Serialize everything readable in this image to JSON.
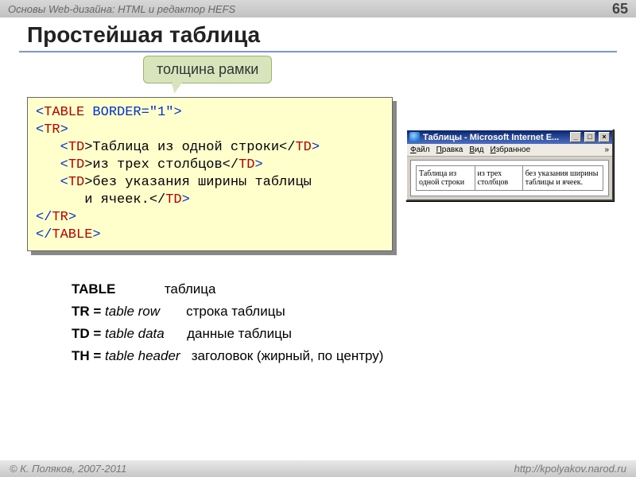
{
  "header": {
    "breadcrumb": "Основы Web-дизайна: HTML и редактор HEFS",
    "page": "65"
  },
  "title": "Простейшая таблица",
  "callout": "толщина рамки",
  "code": {
    "l1a": "<",
    "l1b": "TABLE",
    "l1c": " BORDER=\"1\"",
    "l1d": ">",
    "l2a": "<",
    "l2b": "TR",
    "l2c": ">",
    "l3a": "   <",
    "l3b": "TD",
    "l3c": ">Таблица из одной строки</",
    "l3d": "TD",
    "l3e": ">",
    "l4a": "   <",
    "l4b": "TD",
    "l4c": ">из трех столбцов</",
    "l4d": "TD",
    "l4e": ">",
    "l5a": "   <",
    "l5b": "TD",
    "l5c": ">без указания ширины таблицы",
    "l6": "      и ячеек.</",
    "l6b": "TD",
    "l6c": ">",
    "l7a": "</",
    "l7b": "TR",
    "l7c": ">",
    "l8a": "</",
    "l8b": "TABLE",
    "l8c": ">"
  },
  "browser": {
    "title": "Таблицы - Microsoft Internet E...",
    "menu": {
      "file": "Файл",
      "edit": "Правка",
      "view": "Вид",
      "fav": "Избранное"
    },
    "cells": {
      "c1": "Таблица из одной строки",
      "c2": "из трех столбцов",
      "c3": "без указания ширины таблицы и ячеек."
    }
  },
  "defs": {
    "r1a": "TABLE",
    "r1b": "таблица",
    "r2a": "TR = ",
    "r2b": "table row",
    "r2c": "строка таблицы",
    "r3a": "TD = ",
    "r3b": "table data",
    "r3c": "данные таблицы",
    "r4a": "TH = ",
    "r4b": "table header",
    "r4c": "заголовок (жирный, по центру)"
  },
  "footer": {
    "left": "© К. Поляков, 2007-2011",
    "right": "http://kpolyakov.narod.ru"
  }
}
